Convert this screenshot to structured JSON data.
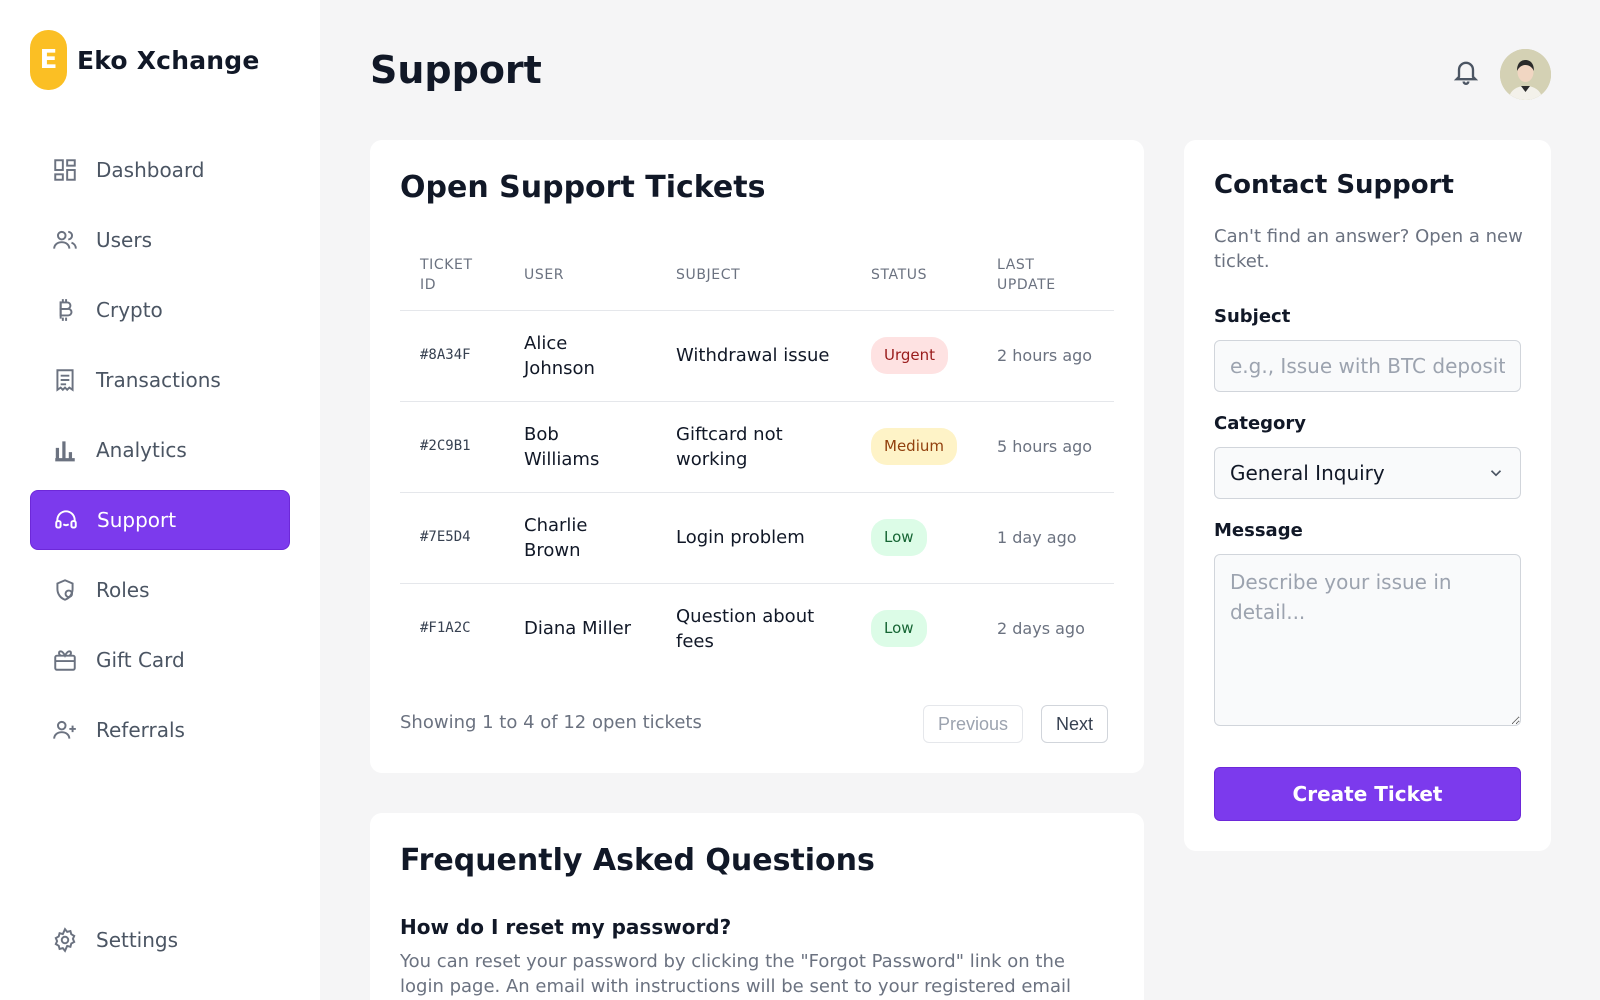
{
  "brand": {
    "logo_letter": "E",
    "name": "Eko Xchange",
    "logo_color": "#fbbf24"
  },
  "sidebar": {
    "items": [
      {
        "label": "Dashboard",
        "icon": "dashboard-icon"
      },
      {
        "label": "Users",
        "icon": "users-icon"
      },
      {
        "label": "Crypto",
        "icon": "bitcoin-icon"
      },
      {
        "label": "Transactions",
        "icon": "receipt-icon"
      },
      {
        "label": "Analytics",
        "icon": "bar-chart-icon"
      },
      {
        "label": "Support",
        "icon": "headset-icon",
        "active": true
      },
      {
        "label": "Roles",
        "icon": "shield-user-icon"
      },
      {
        "label": "Gift Card",
        "icon": "gift-card-icon"
      },
      {
        "label": "Referrals",
        "icon": "user-plus-icon"
      }
    ],
    "settings": {
      "label": "Settings",
      "icon": "gear-icon"
    },
    "active_color": "#7c3aed"
  },
  "header": {
    "title": "Support",
    "bell_icon": "bell-icon",
    "avatar": "avatar"
  },
  "tickets": {
    "title": "Open Support Tickets",
    "columns": [
      "TICKET ID",
      "USER",
      "SUBJECT",
      "STATUS",
      "LAST UPDATE"
    ],
    "rows": [
      {
        "id": "#8A34F",
        "user": "Alice Johnson",
        "subject": "Withdrawal issue",
        "status": "Urgent",
        "status_level": "urgent",
        "updated": "2 hours ago"
      },
      {
        "id": "#2C9B1",
        "user": "Bob Williams",
        "subject": "Giftcard not working",
        "status": "Medium",
        "status_level": "medium",
        "updated": "5 hours ago"
      },
      {
        "id": "#7E5D4",
        "user": "Charlie Brown",
        "subject": "Login problem",
        "status": "Low",
        "status_level": "low",
        "updated": "1 day ago"
      },
      {
        "id": "#F1A2C",
        "user": "Diana Miller",
        "subject": "Question about fees",
        "status": "Low",
        "status_level": "low",
        "updated": "2 days ago"
      }
    ],
    "pagination": {
      "summary": "Showing 1 to 4 of 12 open tickets",
      "previous": "Previous",
      "next": "Next"
    }
  },
  "faq": {
    "title": "Frequently Asked Questions",
    "items": [
      {
        "question": "How do I reset my password?",
        "answer": "You can reset your password by clicking the \"Forgot Password\" link on the login page. An email with instructions will be sent to your registered email address."
      }
    ]
  },
  "contact": {
    "title": "Contact Support",
    "subtitle": "Can't find an answer? Open a new ticket.",
    "subject_label": "Subject",
    "subject_placeholder": "e.g., Issue with BTC deposit",
    "category_label": "Category",
    "category_value": "General Inquiry",
    "message_label": "Message",
    "message_placeholder": "Describe your issue in detail...",
    "submit_label": "Create Ticket"
  }
}
